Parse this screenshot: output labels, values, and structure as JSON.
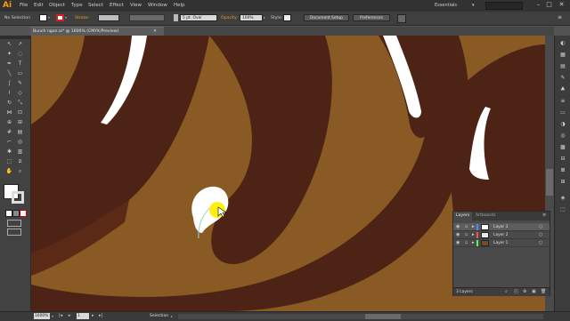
{
  "app": {
    "logo": "Ai"
  },
  "menu": [
    "File",
    "Edit",
    "Object",
    "Type",
    "Select",
    "Effect",
    "View",
    "Window",
    "Help"
  ],
  "workspace": {
    "label": "Essentials"
  },
  "window_controls": {
    "minimize": "–",
    "maximize": "□",
    "close": "✕"
  },
  "control_bar": {
    "selection_label": "No Selection",
    "stroke_label": "Stroke:",
    "brush_value": "5 pt. Oval",
    "opacity_label": "Opacity:",
    "opacity_value": "100%",
    "style_label": "Style:",
    "document_setup": "Document Setup",
    "preferences": "Preferences"
  },
  "document": {
    "tab_title": "Bunch ngon.ai* @ 1600% (CMYK/Preview)",
    "tab_close": "✕"
  },
  "colors": {
    "background": "#8a5a25",
    "chocolate": "#4c2314",
    "highlight": "#ffffff",
    "cursor": "#ffee00"
  },
  "layers_panel": {
    "tabs": [
      "Layers",
      "Artboards"
    ],
    "layers": [
      {
        "name": "Layer 3",
        "color": "#4f87ff"
      },
      {
        "name": "Layer 2",
        "color": "#ff4f4f"
      },
      {
        "name": "Layer 1",
        "color": "#4fff4f"
      }
    ],
    "footer": "3 Layers"
  },
  "status_bar": {
    "zoom": "1600%",
    "page": "1",
    "tool": "Selection"
  },
  "icons": {
    "tools": [
      "selection-tool-icon",
      "direct-selection-tool-icon",
      "magic-wand-tool-icon",
      "lasso-tool-icon",
      "pen-tool-icon",
      "type-tool-icon",
      "line-tool-icon",
      "rectangle-tool-icon",
      "paintbrush-tool-icon",
      "pencil-tool-icon",
      "blob-brush-tool-icon",
      "eraser-tool-icon",
      "rotate-tool-icon",
      "scale-tool-icon",
      "width-tool-icon",
      "free-transform-tool-icon",
      "shape-builder-tool-icon",
      "perspective-grid-tool-icon",
      "mesh-tool-icon",
      "gradient-tool-icon",
      "eyedropper-tool-icon",
      "blend-tool-icon",
      "symbol-sprayer-tool-icon",
      "column-graph-tool-icon",
      "artboard-tool-icon",
      "slice-tool-icon",
      "hand-tool-icon",
      "zoom-tool-icon"
    ]
  }
}
